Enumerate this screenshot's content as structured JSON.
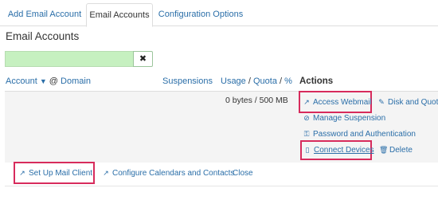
{
  "tabs": [
    {
      "label": "Add Email Account",
      "active": false
    },
    {
      "label": "Email Accounts",
      "active": true
    },
    {
      "label": "Configuration Options",
      "active": false
    }
  ],
  "page_title": "Email Accounts",
  "search": {
    "value": "",
    "clear_icon": "times-icon"
  },
  "table": {
    "headers": {
      "account": "Account",
      "sort_indicator": "▼",
      "at": "@",
      "domain": "Domain",
      "suspensions": "Suspensions",
      "usage": "Usage",
      "slash1": "/",
      "quota": "Quota",
      "slash2": "/",
      "percent": "%",
      "actions": "Actions"
    },
    "row": {
      "quota_text": "0 bytes / 500 MB",
      "actions": {
        "access_webmail": "Access Webmail",
        "disk_and_quota": "Disk and Quota",
        "manage_suspension": "Manage Suspension",
        "password_auth": "Password and Authentication",
        "connect_devices": "Connect Devices",
        "delete": "Delete"
      }
    }
  },
  "bottom_actions": {
    "setup_mail_client": "Set Up Mail Client",
    "configure_calendars": "Configure Calendars and Contacts",
    "close": "Close"
  },
  "colors": {
    "link": "#2a6ea8",
    "highlight": "#d72b5c",
    "search_bg": "#c6f0c0"
  }
}
